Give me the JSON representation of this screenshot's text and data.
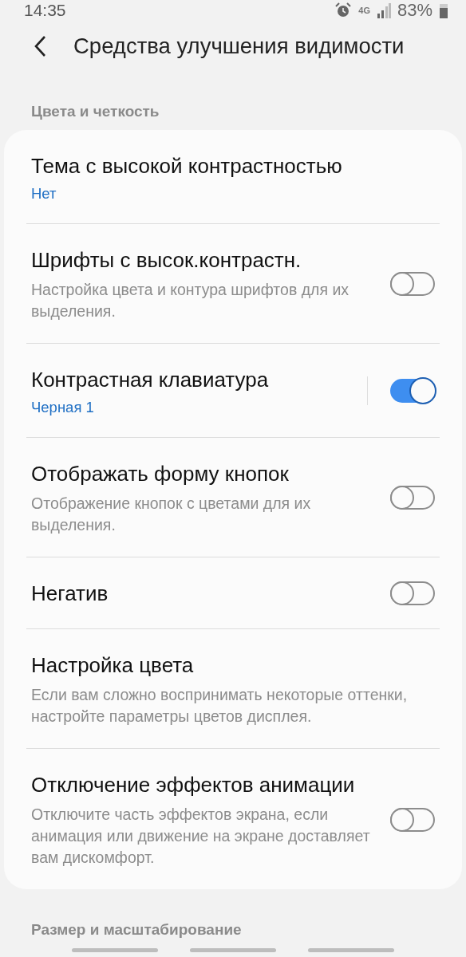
{
  "status_bar": {
    "time": "14:35",
    "network": "4G",
    "battery": "83%"
  },
  "header": {
    "title": "Средства улучшения видимости"
  },
  "sections": [
    {
      "title": "Цвета и четкость",
      "items": [
        {
          "title": "Тема с высокой контрастностью",
          "value": "Нет"
        },
        {
          "title": "Шрифты с высок.контрастн.",
          "summary": "Настройка цвета и контура шрифтов для их выделения.",
          "toggle": {
            "on": false
          }
        },
        {
          "title": "Контрастная клавиатура",
          "value": "Черная 1",
          "toggle": {
            "on": true
          }
        },
        {
          "title": "Отображать форму кнопок",
          "summary": "Отображение кнопок с цветами для их выделения.",
          "toggle": {
            "on": false
          }
        },
        {
          "title": "Негатив",
          "toggle": {
            "on": false
          }
        },
        {
          "title": "Настройка цвета",
          "summary": "Если вам сложно воспринимать некоторые оттенки, настройте параметры цветов дисплея."
        },
        {
          "title": "Отключение эффектов анимации",
          "summary": "Отключите часть эффектов экрана, если анимация или движение на экране доставляет вам дискомфорт.",
          "toggle": {
            "on": false
          }
        }
      ]
    },
    {
      "title": "Размер и масштабирование"
    }
  ]
}
